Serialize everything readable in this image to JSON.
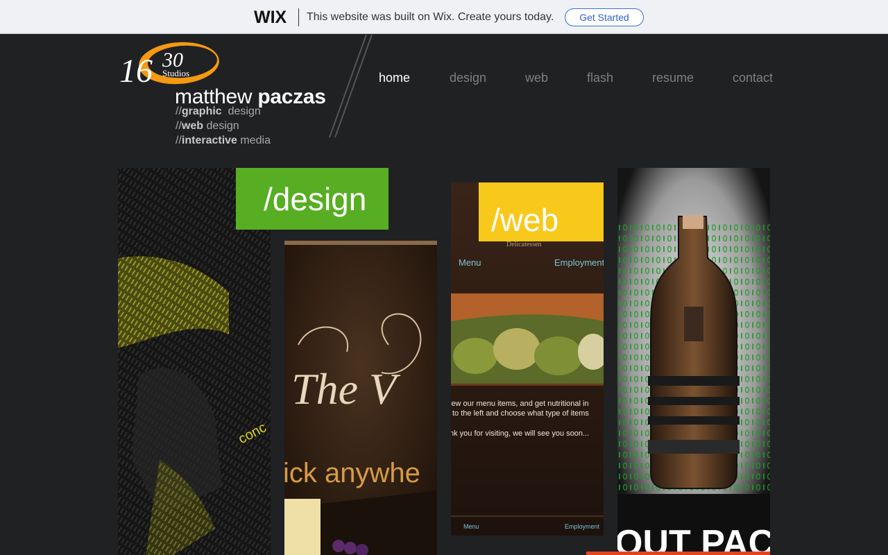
{
  "banner": {
    "logo": "WIX",
    "text": "This website was built on Wix. Create yours today.",
    "button": "Get Started"
  },
  "brand": {
    "logo_main": "16",
    "logo_sup": "30",
    "logo_sub": "Studios",
    "name_first": "matthew ",
    "name_last": "paczas",
    "taglines": [
      {
        "prefix": "//",
        "bold": "graphic",
        "rest": "  design"
      },
      {
        "prefix": "//",
        "bold": "web",
        "rest": " design"
      },
      {
        "prefix": "//",
        "bold": "interactive",
        "rest": " media"
      }
    ]
  },
  "nav": {
    "items": [
      "home",
      "design",
      "web",
      "flash",
      "resume",
      "contact"
    ],
    "active": "home"
  },
  "panels": {
    "design_label": "/design",
    "web_label": "/web",
    "panel2_script": "The V",
    "panel2_text": "ick anywhe",
    "panel3": {
      "deli": "Delicatessen",
      "menu": "Menu",
      "employment": "Employment",
      "line1": "iew our menu items, and get nutritional in",
      "line2": "to the left and choose what type of items",
      "line3": "nk you for visiting, we will see you soon...",
      "footer_menu": "Menu",
      "footer_emp": "Employment"
    },
    "panel1_word": "conc",
    "panel4_text": "OUT PAC"
  },
  "colors": {
    "design_green": "#57ae23",
    "web_yellow": "#f8c91b",
    "bg": "#202123"
  }
}
